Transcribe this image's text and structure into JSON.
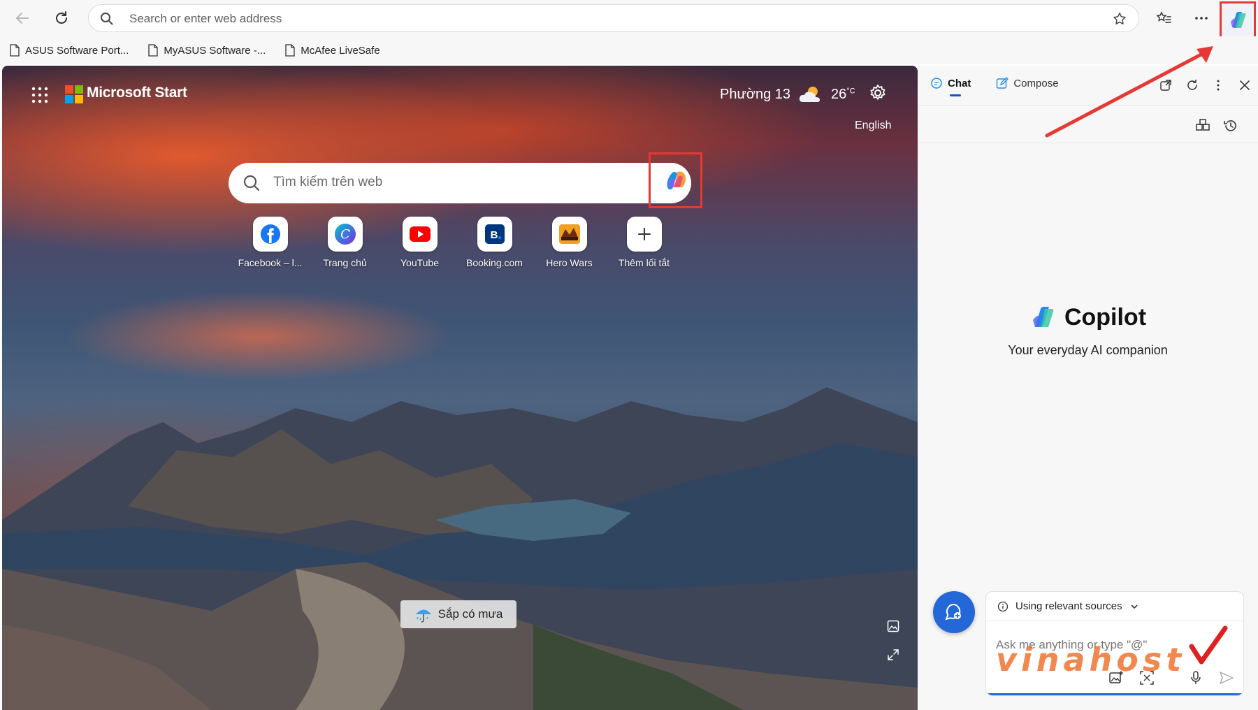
{
  "browser": {
    "address_placeholder": "Search or enter web address",
    "bookmarks": [
      "ASUS Software Port...",
      "MyASUS Software -...",
      "McAfee LiveSafe"
    ]
  },
  "ntp": {
    "brand": "Microsoft Start",
    "location": "Phường 13",
    "temperature": "26",
    "temp_unit": "°C",
    "language": "English",
    "search_placeholder": "Tìm kiếm trên web",
    "tiles": [
      {
        "label": "Facebook – l...",
        "icon": "facebook-icon"
      },
      {
        "label": "Trang chủ",
        "icon": "canva-icon"
      },
      {
        "label": "YouTube",
        "icon": "youtube-icon"
      },
      {
        "label": "Booking.com",
        "icon": "booking-icon"
      },
      {
        "label": "Hero Wars",
        "icon": "hero-wars-icon"
      },
      {
        "label": "Thêm lối tắt",
        "icon": "plus-icon"
      }
    ],
    "rain_notice": "Sắp có mưa"
  },
  "sidebar": {
    "tab_chat": "Chat",
    "tab_compose": "Compose",
    "title": "Copilot",
    "subtitle": "Your everyday AI companion",
    "sources_label": "Using relevant sources",
    "ask_placeholder": "Ask me anything or type \"@\"",
    "watermark": "vinahost"
  },
  "colors": {
    "accent": "#2468d8",
    "highlight": "#e53935"
  }
}
